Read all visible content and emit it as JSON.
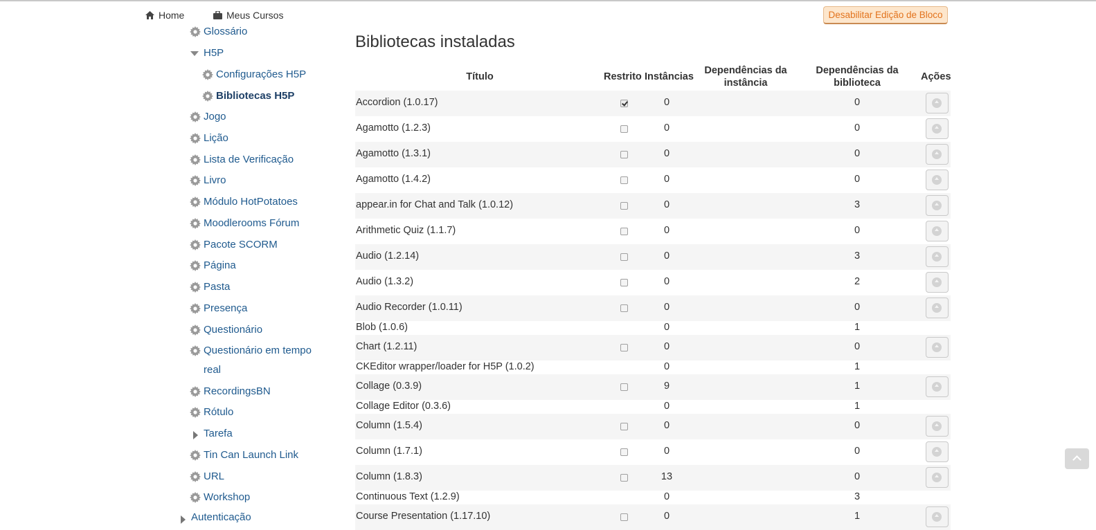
{
  "nav": {
    "home_label": "Home",
    "courses_label": "Meus Cursos"
  },
  "edit_button_label": "Desabilitar Edição de Bloco",
  "sidebar": {
    "top_partial": "Glossário",
    "h5p_label": "H5P",
    "h5p_children": [
      "Configurações H5P",
      "Bibliotecas H5P"
    ],
    "items": [
      "Jogo",
      "Lição",
      "Lista de Verificação",
      "Livro",
      "Módulo HotPotatoes",
      "Moodlerooms Fórum",
      "Pacote SCORM",
      "Página",
      "Pasta",
      "Presença",
      "Questionário",
      "Questionário em tempo",
      "real",
      "RecordingsBN",
      "Rótulo",
      "Tarefa",
      "Tin Can Launch Link",
      "URL",
      "Workshop"
    ],
    "bottom_partial": "Autenticação"
  },
  "main": {
    "title": "Bibliotecas instaladas",
    "headers": {
      "titulo": "Título",
      "restrito": "Restrito",
      "instancias": "Instâncias",
      "dep_instancia_1": "Dependências da",
      "dep_instancia_2": "instância",
      "dep_biblioteca_1": "Dependências da",
      "dep_biblioteca_2": "biblioteca",
      "acoes": "Ações"
    },
    "rows": [
      {
        "title": "Accordion (1.0.17)",
        "restricted": true,
        "has_checkbox": true,
        "instances": "0",
        "lib_deps": "0",
        "has_action": true
      },
      {
        "title": "Agamotto (1.2.3)",
        "restricted": false,
        "has_checkbox": true,
        "instances": "0",
        "lib_deps": "0",
        "has_action": true
      },
      {
        "title": "Agamotto (1.3.1)",
        "restricted": false,
        "has_checkbox": true,
        "instances": "0",
        "lib_deps": "0",
        "has_action": true
      },
      {
        "title": "Agamotto (1.4.2)",
        "restricted": false,
        "has_checkbox": true,
        "instances": "0",
        "lib_deps": "0",
        "has_action": true
      },
      {
        "title": "appear.in for Chat and Talk (1.0.12)",
        "restricted": false,
        "has_checkbox": true,
        "instances": "0",
        "lib_deps": "3",
        "has_action": true
      },
      {
        "title": "Arithmetic Quiz (1.1.7)",
        "restricted": false,
        "has_checkbox": true,
        "instances": "0",
        "lib_deps": "0",
        "has_action": true
      },
      {
        "title": "Audio (1.2.14)",
        "restricted": false,
        "has_checkbox": true,
        "instances": "0",
        "lib_deps": "3",
        "has_action": true
      },
      {
        "title": "Audio (1.3.2)",
        "restricted": false,
        "has_checkbox": true,
        "instances": "0",
        "lib_deps": "2",
        "has_action": true
      },
      {
        "title": "Audio Recorder (1.0.11)",
        "restricted": false,
        "has_checkbox": true,
        "instances": "0",
        "lib_deps": "0",
        "has_action": true
      },
      {
        "title": "Blob (1.0.6)",
        "restricted": false,
        "has_checkbox": false,
        "instances": "0",
        "lib_deps": "1",
        "has_action": false
      },
      {
        "title": "Chart (1.2.11)",
        "restricted": false,
        "has_checkbox": true,
        "instances": "0",
        "lib_deps": "0",
        "has_action": true
      },
      {
        "title": "CKEditor wrapper/loader for H5P (1.0.2)",
        "restricted": false,
        "has_checkbox": false,
        "instances": "0",
        "lib_deps": "1",
        "has_action": false
      },
      {
        "title": "Collage (0.3.9)",
        "restricted": false,
        "has_checkbox": true,
        "instances": "9",
        "lib_deps": "1",
        "has_action": true
      },
      {
        "title": "Collage Editor (0.3.6)",
        "restricted": false,
        "has_checkbox": false,
        "instances": "0",
        "lib_deps": "1",
        "has_action": false
      },
      {
        "title": "Column (1.5.4)",
        "restricted": false,
        "has_checkbox": true,
        "instances": "0",
        "lib_deps": "0",
        "has_action": true
      },
      {
        "title": "Column (1.7.1)",
        "restricted": false,
        "has_checkbox": true,
        "instances": "0",
        "lib_deps": "0",
        "has_action": true
      },
      {
        "title": "Column (1.8.3)",
        "restricted": false,
        "has_checkbox": true,
        "instances": "13",
        "lib_deps": "0",
        "has_action": true
      },
      {
        "title": "Continuous Text (1.2.9)",
        "restricted": false,
        "has_checkbox": false,
        "instances": "0",
        "lib_deps": "3",
        "has_action": false
      },
      {
        "title": "Course Presentation (1.17.10)",
        "restricted": false,
        "has_checkbox": true,
        "instances": "0",
        "lib_deps": "1",
        "has_action": true
      }
    ]
  },
  "colors": {
    "link": "#1f5a8e",
    "accent_orange": "#e2731d",
    "stripe": "#f5f5f5"
  }
}
